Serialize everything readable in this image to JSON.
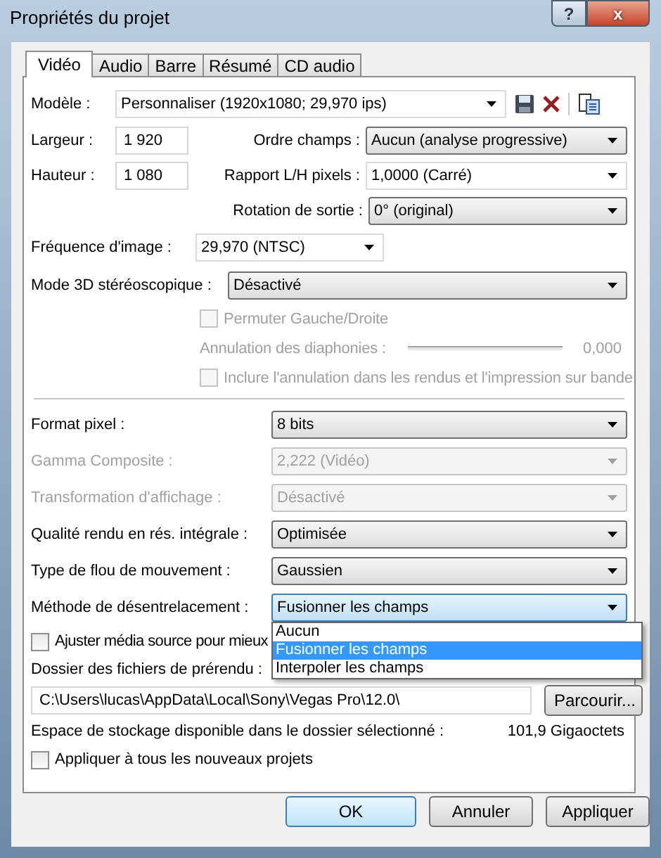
{
  "window": {
    "title": "Propriétés du projet",
    "help": "?",
    "close": "x"
  },
  "tabs": [
    {
      "label": "Vidéo",
      "selected": true
    },
    {
      "label": "Audio",
      "selected": false
    },
    {
      "label": "Barre",
      "selected": false
    },
    {
      "label": "Résumé",
      "selected": false
    },
    {
      "label": "CD audio",
      "selected": false
    }
  ],
  "template": {
    "label": "Modèle :",
    "value": "Personnaliser (1920x1080; 29,970 ips)"
  },
  "width": {
    "label": "Largeur :",
    "value": "1 920"
  },
  "height": {
    "label": "Hauteur :",
    "value": "1 080"
  },
  "field_order": {
    "label": "Ordre champs :",
    "value": "Aucun (analyse progressive)"
  },
  "pixel_aspect": {
    "label": "Rapport L/H pixels :",
    "value": "1,0000 (Carré)"
  },
  "rotation": {
    "label": "Rotation de sortie :",
    "value": "0° (original)"
  },
  "frame_rate": {
    "label": "Fréquence d'image :",
    "value": "29,970 (NTSC)"
  },
  "stereo_mode": {
    "label": "Mode 3D stéréoscopique :",
    "value": "Désactivé"
  },
  "swap": {
    "label": "Permuter Gauche/Droite",
    "checked": false,
    "disabled": true
  },
  "crosstalk": {
    "label": "Annulation des diaphonies :",
    "reading": "0,000",
    "disabled": true
  },
  "include": {
    "label": "Inclure l'annulation dans les rendus et l'impression sur bande",
    "checked": false,
    "disabled": true
  },
  "settings": [
    {
      "label": "Format pixel :",
      "value": "8 bits",
      "disabled": false,
      "expanded": false
    },
    {
      "label": "Gamma Composite :",
      "value": "2,222 (Vidéo)",
      "disabled": true,
      "expanded": false
    },
    {
      "label": "Transformation d'affichage :",
      "value": "Désactivé",
      "disabled": true,
      "expanded": false
    },
    {
      "label": "Qualité rendu en rés. intégrale :",
      "value": "Optimisée",
      "disabled": false,
      "expanded": false
    },
    {
      "label": "Type de flou de mouvement :",
      "value": "Gaussien",
      "disabled": false,
      "expanded": false
    },
    {
      "label": "Méthode de désentrelacement :",
      "value": "Fusionner les champs",
      "disabled": false,
      "expanded": true,
      "options": [
        {
          "label": "Aucun",
          "selected": false
        },
        {
          "label": "Fusionner les champs",
          "selected": true
        },
        {
          "label": "Interpoler les champs",
          "selected": false
        }
      ]
    }
  ],
  "adjust": {
    "label": "Ajuster média source pour mieux",
    "checked": false
  },
  "prerender": {
    "label": "Dossier des fichiers de prérendu :",
    "value": "C:\\Users\\lucas\\AppData\\Local\\Sony\\Vegas Pro\\12.0\\",
    "browse": "Parcourir..."
  },
  "storage": {
    "label": "Espace de stockage disponible dans le dossier sélectionné :",
    "value": "101,9 Gigaoctets"
  },
  "apply_all": {
    "label": "Appliquer à tous les nouveaux projets",
    "checked": false
  },
  "buttons": [
    {
      "label": "OK",
      "default": true
    },
    {
      "label": "Annuler",
      "default": false
    },
    {
      "label": "Appliquer",
      "default": false
    }
  ]
}
